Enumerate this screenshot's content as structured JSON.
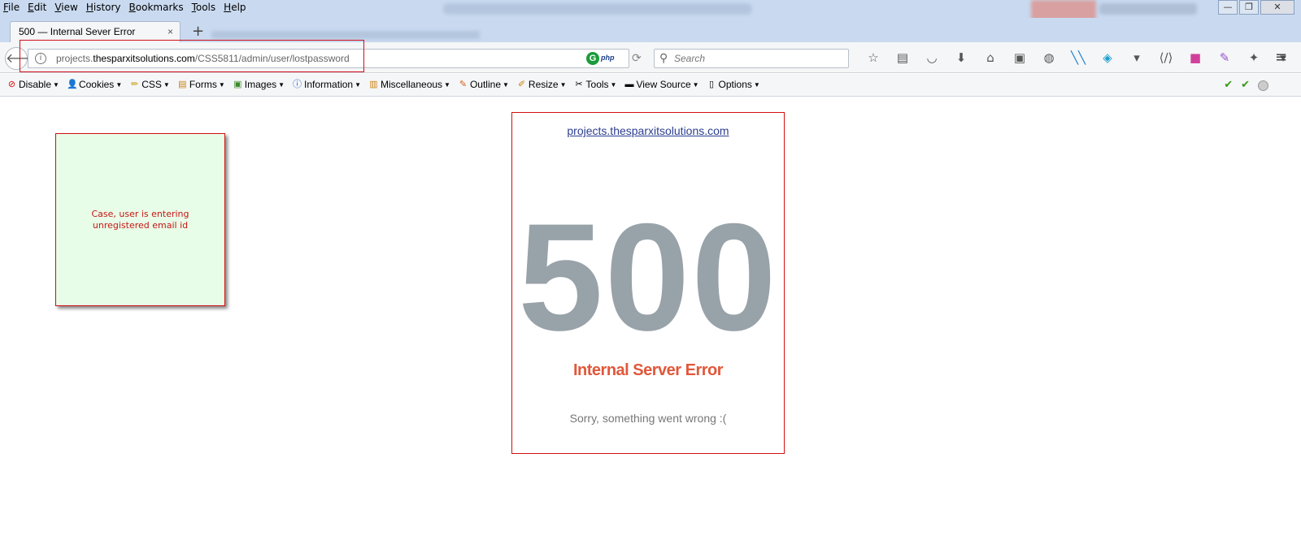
{
  "menu": [
    "File",
    "Edit",
    "View",
    "History",
    "Bookmarks",
    "Tools",
    "Help"
  ],
  "window_controls": {
    "minimize": "—",
    "restore": "❐",
    "close": "✕"
  },
  "tab": {
    "title": "500 — Internal Sever Error",
    "close": "×",
    "new_tab": "+"
  },
  "urlbar": {
    "url_prefix": "projects.",
    "url_domain": "thesparxitsolutions.com",
    "url_path": "/CSS5811/admin/user/lostpassword",
    "php_badge": "php",
    "g_badge": "G"
  },
  "search": {
    "placeholder": "Search"
  },
  "devtoolbar": {
    "items": [
      "Disable",
      "Cookies",
      "CSS",
      "Forms",
      "Images",
      "Information",
      "Miscellaneous",
      "Outline",
      "Resize",
      "Tools",
      "View Source",
      "Options"
    ]
  },
  "note": {
    "text": "Case, user is entering unregistered email id"
  },
  "error_page": {
    "domain_link": "projects.thesparxitsolutions.com",
    "code": "500",
    "title": "Internal Server Error",
    "message": "Sorry, something went wrong :("
  },
  "colors": {
    "error_code": "#98a2a9",
    "error_title": "#e1583b",
    "annotation_border": "#d01010",
    "note_bg": "#e8fde8"
  }
}
